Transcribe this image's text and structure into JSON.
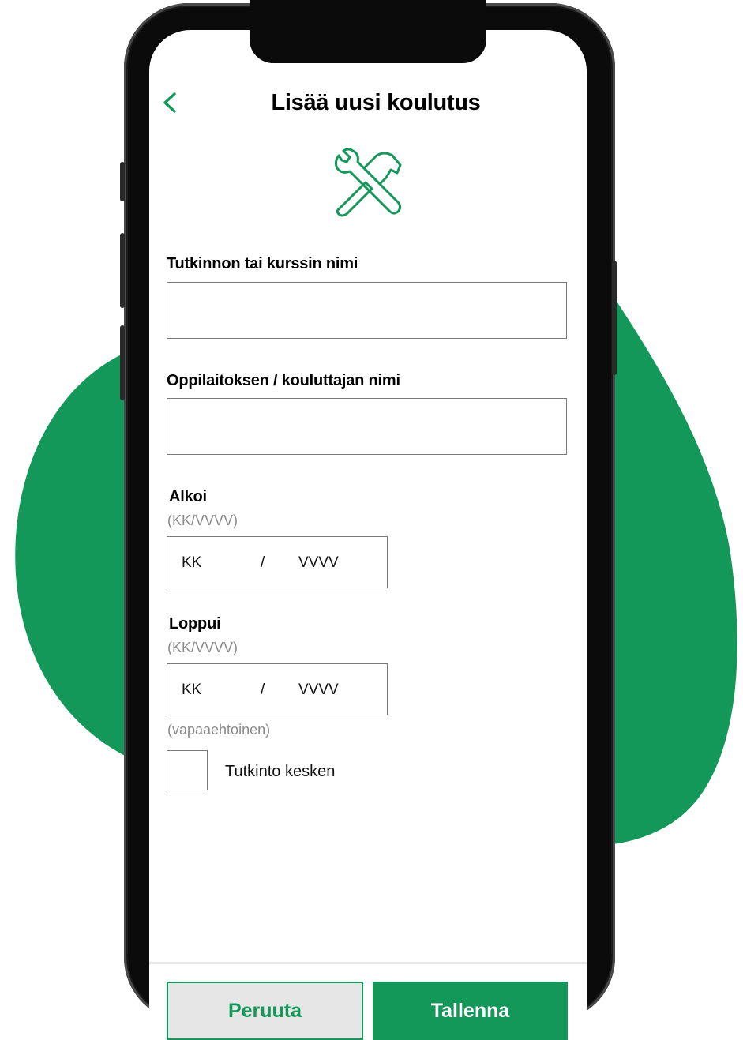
{
  "colors": {
    "accent": "#14985a",
    "blob": "#14985a",
    "phone_frame": "#0b0b0b"
  },
  "header": {
    "back_icon": "chevron-left-icon",
    "title": "Lisää uusi koulutus"
  },
  "hero_icon": "tools-icon",
  "form": {
    "degree_label": "Tutkinnon tai kurssin nimi",
    "degree_value": "",
    "school_label": "Oppilaitoksen / kouluttajan nimi",
    "school_value": "",
    "start": {
      "label": "Alkoi",
      "hint": "(KK/VVVV)",
      "month": "KK",
      "separator": "/",
      "year": "VVVV"
    },
    "end": {
      "label": "Loppui",
      "hint": "(KK/VVVV)",
      "month": "KK",
      "separator": "/",
      "year": "VVVV",
      "optional_hint": "(vapaaehtoinen)"
    },
    "in_progress_label": "Tutkinto kesken",
    "in_progress_checked": false
  },
  "actions": {
    "cancel_label": "Peruuta",
    "save_label": "Tallenna"
  }
}
